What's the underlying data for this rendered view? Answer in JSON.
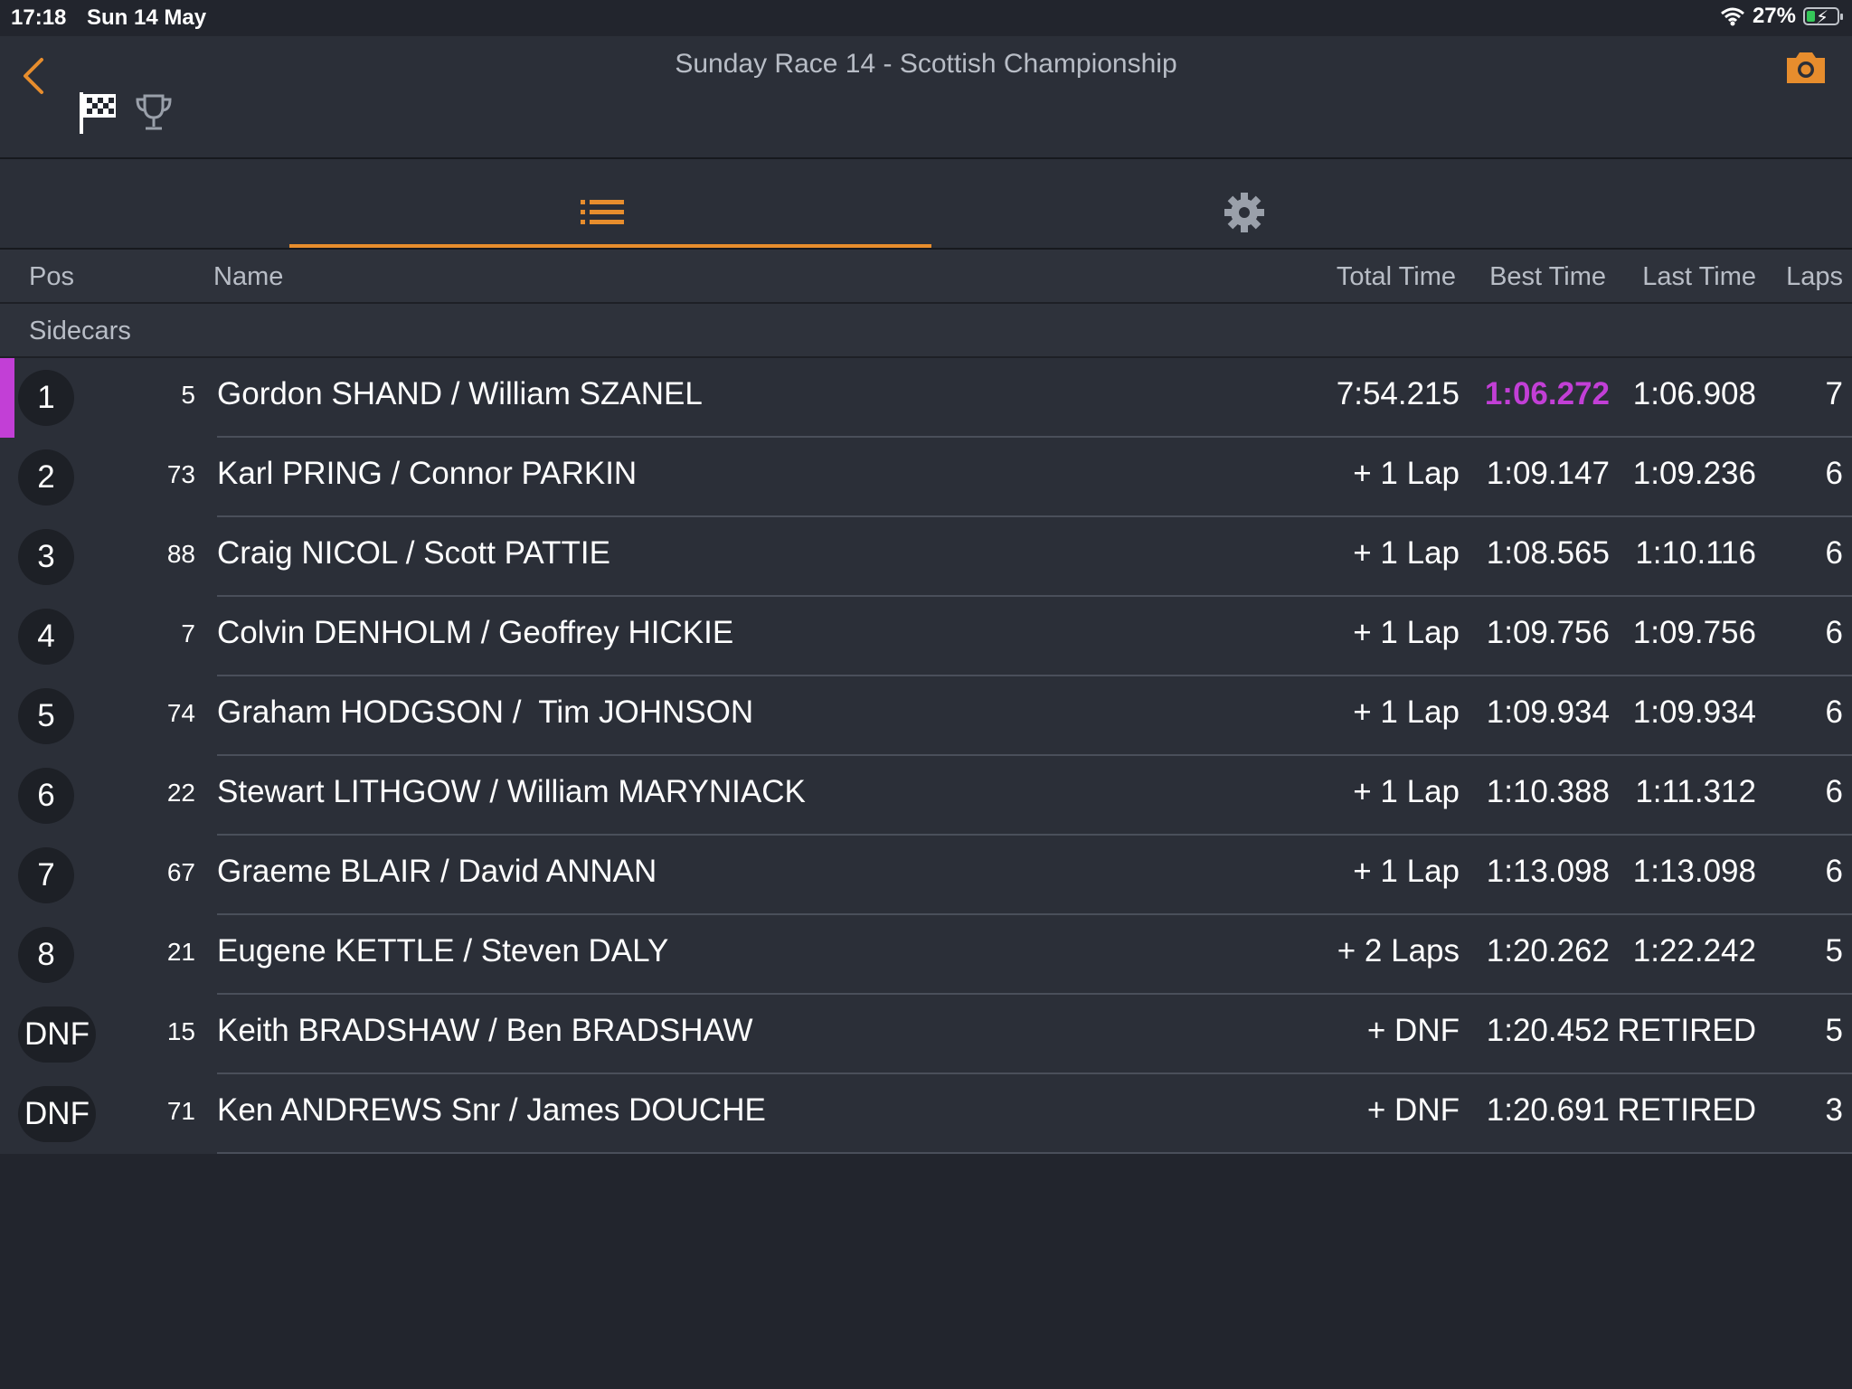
{
  "status_bar": {
    "time": "17:18",
    "date": "Sun 14 May",
    "battery": "27%",
    "battery_level": 0.27
  },
  "header": {
    "title": "Sunday Race 14 - Scottish Championship",
    "back_icon": "chevron-left-icon",
    "flag_icon": "checkered-flag-icon",
    "trophy_icon": "trophy-icon",
    "camera_icon": "camera-icon"
  },
  "tabs": [
    {
      "name": "results-list",
      "icon": "list-icon",
      "selected": true
    },
    {
      "name": "settings",
      "icon": "gear-icon",
      "selected": false
    }
  ],
  "columns": {
    "pos": "Pos",
    "name": "Name",
    "total": "Total Time",
    "best": "Best Time",
    "last": "Last Time",
    "laps": "Laps"
  },
  "group": "Sidecars",
  "colors": {
    "accent": "#e78d2d",
    "fastest": "#c23fd6",
    "background": "#22252d",
    "row": "#2b2f38"
  },
  "rows": [
    {
      "pos": "1",
      "num": "5",
      "name": "Gordon SHAND / William SZANEL",
      "total": "7:54.215",
      "best": "1:06.272",
      "last": "1:06.908",
      "laps": "7",
      "fastest": true
    },
    {
      "pos": "2",
      "num": "73",
      "name": "Karl PRING / Connor PARKIN",
      "total": "+ 1 Lap",
      "best": "1:09.147",
      "last": "1:09.236",
      "laps": "6"
    },
    {
      "pos": "3",
      "num": "88",
      "name": "Craig NICOL / Scott PATTIE",
      "total": "+ 1 Lap",
      "best": "1:08.565",
      "last": "1:10.116",
      "laps": "6"
    },
    {
      "pos": "4",
      "num": "7",
      "name": "Colvin DENHOLM / Geoffrey HICKIE",
      "total": "+ 1 Lap",
      "best": "1:09.756",
      "last": "1:09.756",
      "laps": "6"
    },
    {
      "pos": "5",
      "num": "74",
      "name": "Graham HODGSON /  Tim JOHNSON",
      "total": "+ 1 Lap",
      "best": "1:09.934",
      "last": "1:09.934",
      "laps": "6"
    },
    {
      "pos": "6",
      "num": "22",
      "name": "Stewart LITHGOW / William MARYNIACK",
      "total": "+ 1 Lap",
      "best": "1:10.388",
      "last": "1:11.312",
      "laps": "6"
    },
    {
      "pos": "7",
      "num": "67",
      "name": "Graeme BLAIR / David ANNAN",
      "total": "+ 1 Lap",
      "best": "1:13.098",
      "last": "1:13.098",
      "laps": "6"
    },
    {
      "pos": "8",
      "num": "21",
      "name": "Eugene KETTLE / Steven DALY",
      "total": "+ 2 Laps",
      "best": "1:20.262",
      "last": "1:22.242",
      "laps": "5"
    },
    {
      "pos": "DNF",
      "num": "15",
      "name": "Keith BRADSHAW / Ben BRADSHAW",
      "total": "+ DNF",
      "best": "1:20.452",
      "last": "RETIRED",
      "laps": "5"
    },
    {
      "pos": "DNF",
      "num": "71",
      "name": "Ken ANDREWS Snr / James DOUCHE",
      "total": "+ DNF",
      "best": "1:20.691",
      "last": "RETIRED",
      "laps": "3"
    }
  ]
}
